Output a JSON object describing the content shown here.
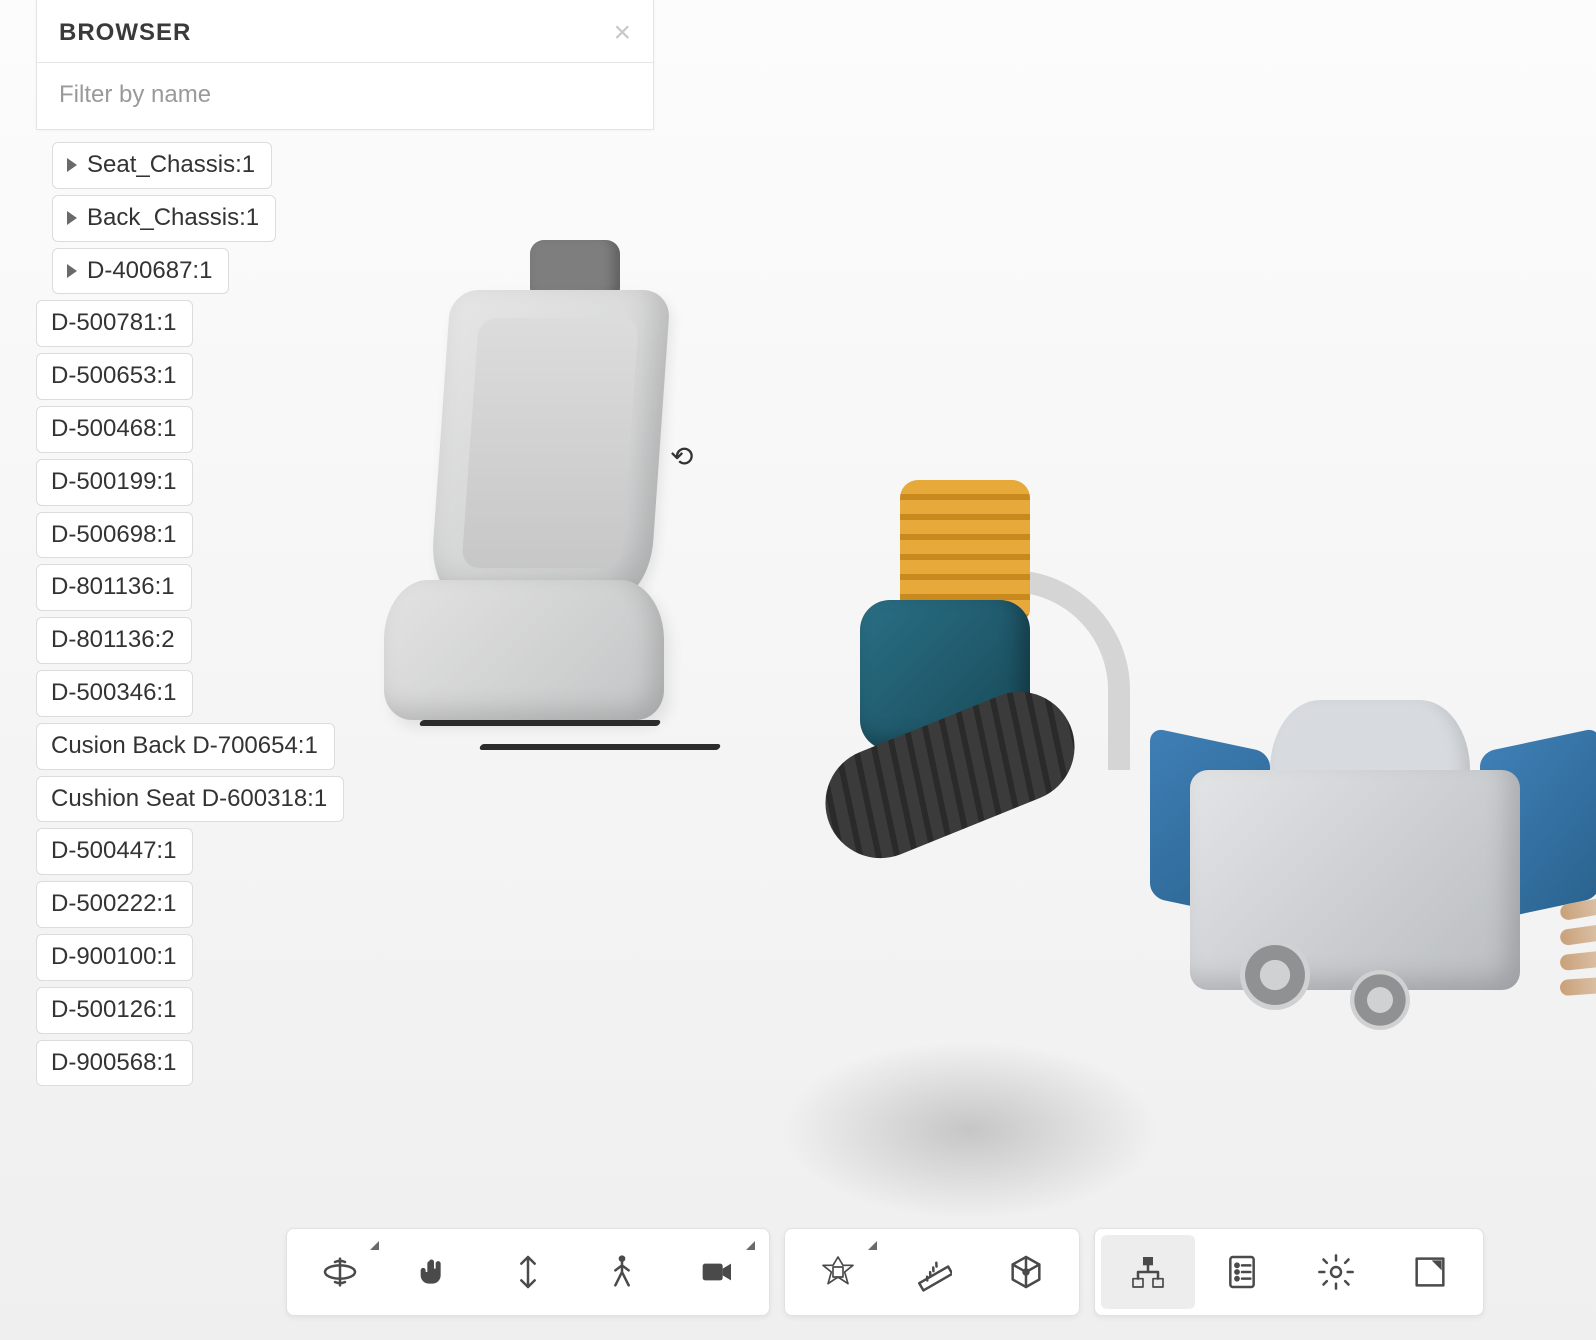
{
  "browser": {
    "title": "BROWSER",
    "filter_placeholder": "Filter by name",
    "items": [
      {
        "label": "Seat_Chassis:1",
        "expandable": true,
        "indent": true
      },
      {
        "label": "Back_Chassis:1",
        "expandable": true,
        "indent": true
      },
      {
        "label": "D-400687:1",
        "expandable": true,
        "indent": true
      },
      {
        "label": "D-500781:1",
        "expandable": false,
        "indent": false
      },
      {
        "label": "D-500653:1",
        "expandable": false,
        "indent": false
      },
      {
        "label": "D-500468:1",
        "expandable": false,
        "indent": false
      },
      {
        "label": "D-500199:1",
        "expandable": false,
        "indent": false
      },
      {
        "label": "D-500698:1",
        "expandable": false,
        "indent": false
      },
      {
        "label": "D-801136:1",
        "expandable": false,
        "indent": false
      },
      {
        "label": "D-801136:2",
        "expandable": false,
        "indent": false
      },
      {
        "label": "D-500346:1",
        "expandable": false,
        "indent": false
      },
      {
        "label": "Cusion Back D-700654:1",
        "expandable": false,
        "indent": false
      },
      {
        "label": "Cushion Seat D-600318:1",
        "expandable": false,
        "indent": false
      },
      {
        "label": "D-500447:1",
        "expandable": false,
        "indent": false
      },
      {
        "label": "D-500222:1",
        "expandable": false,
        "indent": false
      },
      {
        "label": "D-900100:1",
        "expandable": false,
        "indent": false
      },
      {
        "label": "D-500126:1",
        "expandable": false,
        "indent": false
      },
      {
        "label": "D-900568:1",
        "expandable": false,
        "indent": false
      }
    ]
  },
  "toolbar": {
    "groups": [
      {
        "name": "navigation",
        "buttons": [
          {
            "id": "orbit",
            "has_menu": true
          },
          {
            "id": "pan",
            "has_menu": false
          },
          {
            "id": "updown",
            "has_menu": false
          },
          {
            "id": "walk",
            "has_menu": false
          },
          {
            "id": "camera",
            "has_menu": true
          }
        ]
      },
      {
        "name": "inspect",
        "buttons": [
          {
            "id": "explode",
            "has_menu": true
          },
          {
            "id": "measure",
            "has_menu": false
          },
          {
            "id": "section",
            "has_menu": false
          }
        ]
      },
      {
        "name": "panels",
        "buttons": [
          {
            "id": "model-tree",
            "has_menu": false,
            "active": true
          },
          {
            "id": "properties",
            "has_menu": false
          },
          {
            "id": "settings",
            "has_menu": false
          },
          {
            "id": "fullscreen",
            "has_menu": false
          }
        ]
      }
    ]
  },
  "scene_models": [
    "car-seat",
    "nitro-engine",
    "v8-engine"
  ]
}
